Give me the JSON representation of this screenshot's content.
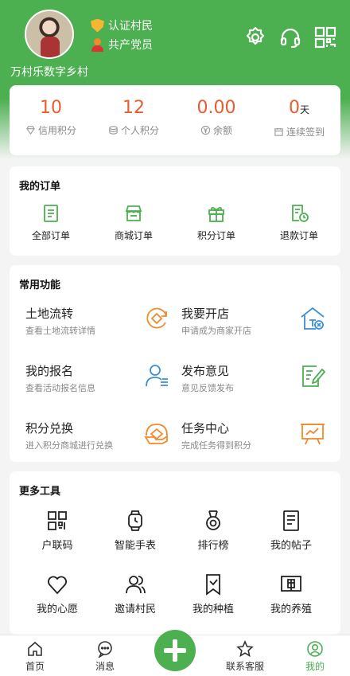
{
  "header": {
    "badges": [
      "认证村民",
      "共产党员"
    ],
    "village": "万村乐数字乡村",
    "icons": [
      "settings-icon",
      "headset-icon",
      "qrcode-icon"
    ]
  },
  "stats": [
    {
      "value": "10",
      "unit": "",
      "label": "信用积分",
      "icon": "diamond-icon"
    },
    {
      "value": "12",
      "unit": "",
      "label": "个人积分",
      "icon": "coins-icon"
    },
    {
      "value": "0.00",
      "unit": "",
      "label": "余额",
      "icon": "yen-icon"
    },
    {
      "value": "0",
      "unit": "天",
      "label": "连续签到",
      "icon": "calendar-icon"
    }
  ],
  "orders": {
    "title": "我的订单",
    "items": [
      {
        "label": "全部订单",
        "icon": "document-icon"
      },
      {
        "label": "商城订单",
        "icon": "shop-icon"
      },
      {
        "label": "积分订单",
        "icon": "gift-icon"
      },
      {
        "label": "退款订单",
        "icon": "refund-icon"
      }
    ]
  },
  "functions": {
    "title": "常用功能",
    "items": [
      {
        "title": "土地流转",
        "sub": "查看土地流转详情",
        "icon": "land-transfer-icon"
      },
      {
        "title": "我要开店",
        "sub": "申请成为商家开店",
        "icon": "store-house-icon"
      },
      {
        "title": "我的报名",
        "sub": "查看活动报名信息",
        "icon": "user-list-icon"
      },
      {
        "title": "发布意见",
        "sub": "意见反馈发布",
        "icon": "edit-note-icon"
      },
      {
        "title": "积分兑换",
        "sub": "进入积分商城进行兑换",
        "icon": "exchange-hand-icon"
      },
      {
        "title": "任务中心",
        "sub": "完成任务得到积分",
        "icon": "task-board-icon"
      }
    ]
  },
  "tools": {
    "title": "更多工具",
    "items": [
      {
        "label": "户联码",
        "icon": "qrcode-icon"
      },
      {
        "label": "智能手表",
        "icon": "watch-icon"
      },
      {
        "label": "排行榜",
        "icon": "medal-icon"
      },
      {
        "label": "我的帖子",
        "icon": "post-icon"
      },
      {
        "label": "我的心愿",
        "icon": "heart-icon"
      },
      {
        "label": "邀请村民",
        "icon": "users-icon"
      },
      {
        "label": "我的种植",
        "icon": "plant-bookmark-icon"
      },
      {
        "label": "我的养殖",
        "icon": "livestock-icon"
      }
    ]
  },
  "tabbar": {
    "items": [
      {
        "label": "首页",
        "icon": "home-icon"
      },
      {
        "label": "消息",
        "icon": "message-icon"
      },
      {
        "label": "",
        "icon": "plus-icon"
      },
      {
        "label": "联系客服",
        "icon": "star-icon"
      },
      {
        "label": "我的",
        "icon": "profile-icon"
      }
    ],
    "active": "我的"
  },
  "colors": {
    "brand": "#4caf50",
    "accent": "#e85d2e",
    "orange_icon": "#f08a2c",
    "blue_icon": "#3a8fd6",
    "green_icon": "#4caf50"
  }
}
